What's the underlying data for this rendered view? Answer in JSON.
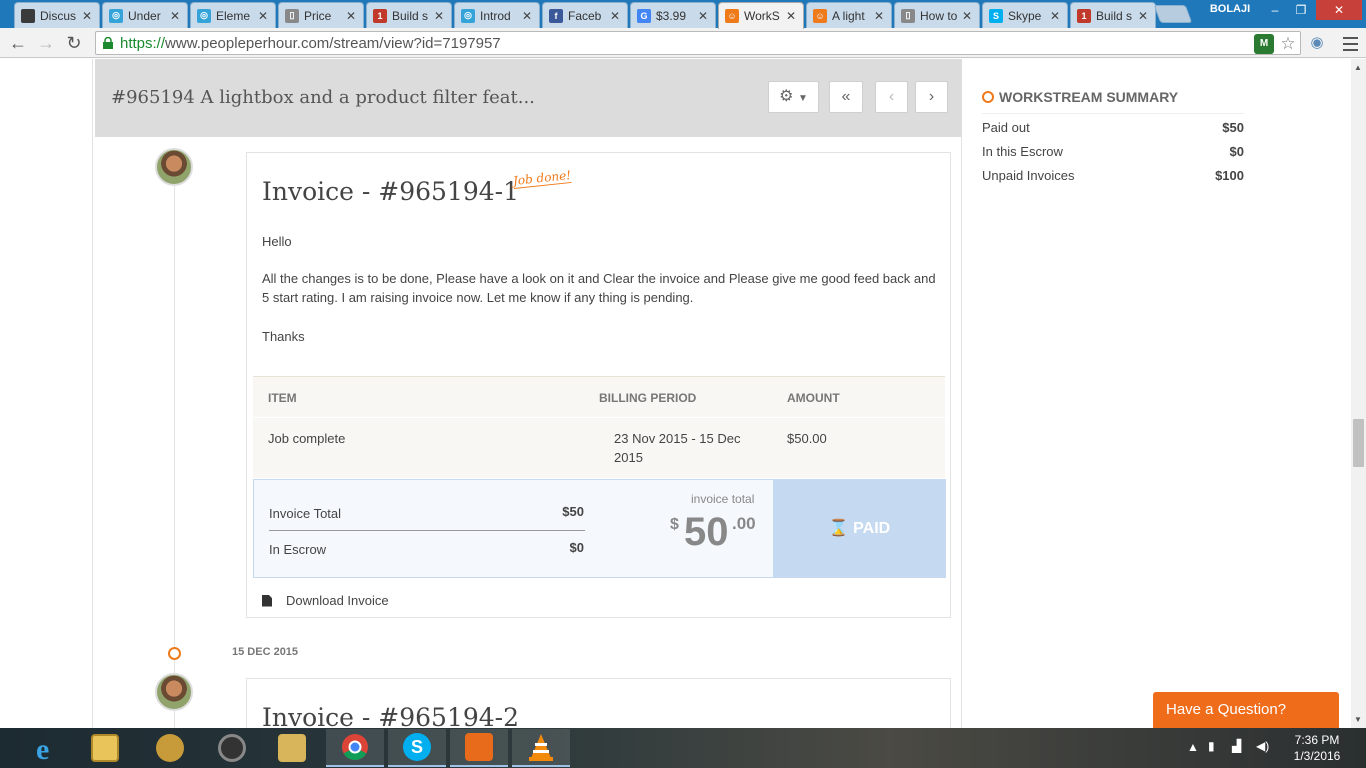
{
  "browser": {
    "tabs": [
      {
        "title": "Discus",
        "color": "#3a3a3a",
        "glyph": ""
      },
      {
        "title": "Under",
        "color": "#34a3d8",
        "glyph": "◎"
      },
      {
        "title": "Eleme",
        "color": "#34a3d8",
        "glyph": "◎"
      },
      {
        "title": "Price",
        "color": "#888888",
        "glyph": "▯"
      },
      {
        "title": "Build s",
        "color": "#c0392b",
        "glyph": "1"
      },
      {
        "title": "Introd",
        "color": "#34a3d8",
        "glyph": "◎"
      },
      {
        "title": "Faceb",
        "color": "#3b5998",
        "glyph": "f"
      },
      {
        "title": "$3.99",
        "color": "#4285f4",
        "glyph": "G"
      },
      {
        "title": "WorkS",
        "color": "#ef7a1a",
        "glyph": "☺"
      },
      {
        "title": "A light",
        "color": "#ef7a1a",
        "glyph": "☺"
      },
      {
        "title": "How to",
        "color": "#888888",
        "glyph": "▯"
      },
      {
        "title": "Skype",
        "color": "#00aff0",
        "glyph": "S"
      },
      {
        "title": "Build s",
        "color": "#c0392b",
        "glyph": "1"
      }
    ],
    "active_tab": 8,
    "profile": "BOLAJI",
    "url_scheme": "https://",
    "url_rest": "www.peopleperhour.com/stream/view?id=7197957",
    "extension_label": "M"
  },
  "page": {
    "header_title": "#965194 A lightbox and a product filter feat...",
    "invoice1": {
      "title": "Invoice - #965194-1",
      "badge": "Job done!",
      "greeting": "Hello",
      "body": "All the changes is to be done, Please have a look on it and Clear the invoice and Please give me good feed back and 5 start rating. I am raising invoice now. Let me know if any thing is pending.",
      "signoff": "Thanks",
      "table_headers": {
        "item": "ITEM",
        "period": "BILLING PERIOD",
        "amount": "AMOUNT"
      },
      "rows": [
        {
          "item": "Job complete",
          "period": "23 Nov 2015 - 15 Dec 2015",
          "amount": "$50.00"
        }
      ],
      "totals": {
        "invoice_total_label": "Invoice Total",
        "invoice_total_value": "$50",
        "escrow_label": "In Escrow",
        "escrow_value": "$0",
        "big_label": "invoice total",
        "big_currency": "$",
        "big_int": "50",
        "big_dec": ".00",
        "status": "PAID",
        "status_icon": "⌛"
      },
      "download_label": "Download Invoice"
    },
    "timeline_date": "15 DEC 2015",
    "invoice2": {
      "title": "Invoice - #965194-2"
    }
  },
  "summary": {
    "heading": "WORKSTREAM SUMMARY",
    "rows": [
      {
        "label": "Paid out",
        "value": "$50"
      },
      {
        "label": "In this Escrow",
        "value": "$0"
      },
      {
        "label": "Unpaid Invoices",
        "value": "$100"
      }
    ]
  },
  "question_widget": "Have a Question?",
  "taskbar": {
    "time": "7:36 PM",
    "date": "1/3/2016"
  },
  "colors": {
    "accent": "#ef7a1a",
    "paid_bg": "#c5daf0"
  }
}
